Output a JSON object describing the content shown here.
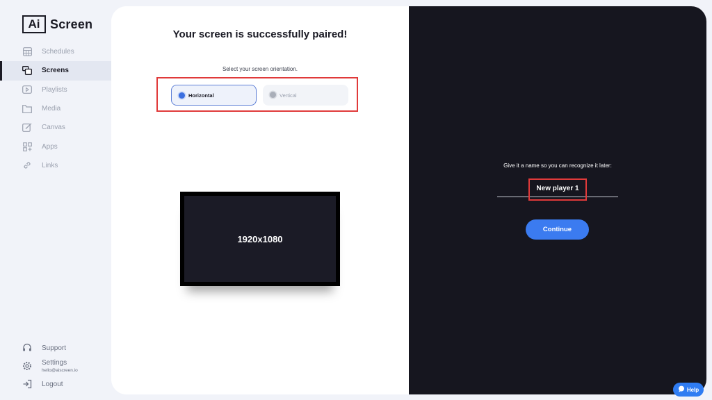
{
  "brand": {
    "box": "Ai",
    "name": "Screen"
  },
  "sidebar": {
    "items": [
      {
        "label": "Schedules",
        "icon": "calendar-grid-icon"
      },
      {
        "label": "Screens",
        "icon": "screens-icon"
      },
      {
        "label": "Playlists",
        "icon": "playlist-icon"
      },
      {
        "label": "Media",
        "icon": "folder-icon"
      },
      {
        "label": "Canvas",
        "icon": "canvas-edit-icon"
      },
      {
        "label": "Apps",
        "icon": "apps-grid-icon"
      },
      {
        "label": "Links",
        "icon": "link-icon"
      }
    ],
    "support": "Support",
    "settings": "Settings",
    "email": "hello@aiscreen.io",
    "logout": "Logout"
  },
  "pairing": {
    "title": "Your screen is successfully paired!",
    "orientation_prompt": "Select your screen orientation.",
    "options": {
      "horizontal": "Horizontal",
      "vertical": "Vertical"
    },
    "selected": "Horizontal",
    "resolution": "1920x1080"
  },
  "naming": {
    "prompt": "Give it a name so you can recognize it later:",
    "value": "New player 1",
    "continue": "Continue"
  },
  "help": "Help",
  "colors": {
    "accent": "#3b7bf0",
    "dark_panel": "#16161f",
    "highlight": "#e03a3a"
  }
}
